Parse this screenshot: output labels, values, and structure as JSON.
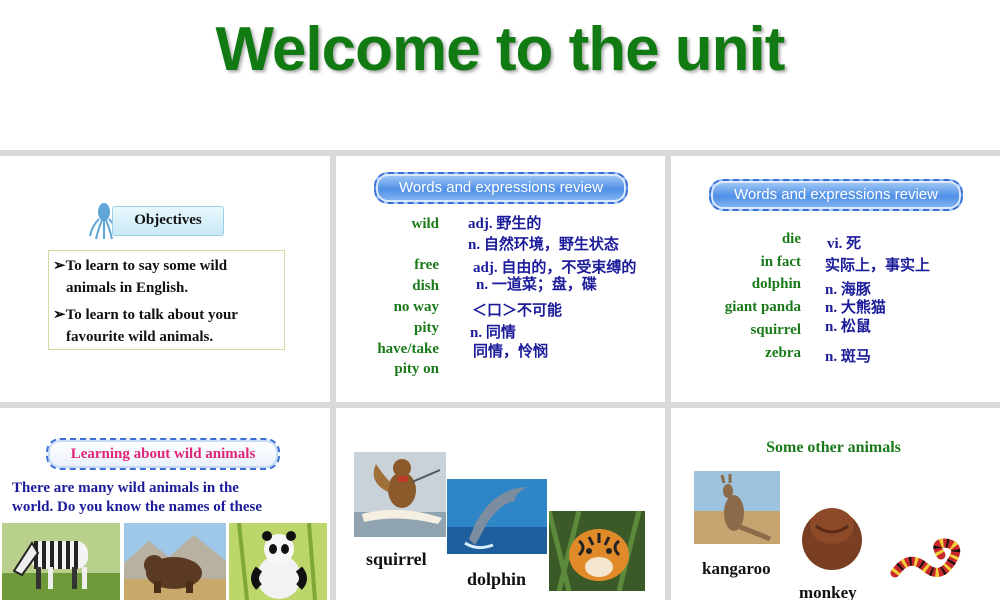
{
  "title": "Welcome to the unit",
  "objectives": {
    "label": "Objectives",
    "lines": [
      "➢To learn to say some wild",
      "animals in English.",
      "➢To learn to talk about your",
      "favourite wild animals."
    ]
  },
  "review_label": "Words and expressions review",
  "vocab1": {
    "words": [
      "wild",
      "free",
      "dish",
      "no way",
      "pity",
      "have/take",
      "pity on"
    ],
    "meanings": [
      "adj.  野生的",
      "n.  自然环境，野生状态",
      "adj.  自由的，不受束缚的",
      "n.  一道菜；盘，碟",
      "＜口＞不可能",
      "n.  同情",
      "同情，怜悯"
    ]
  },
  "vocab2": {
    "words": [
      "die",
      "in fact",
      "dolphin",
      "giant panda",
      "squirrel",
      "zebra"
    ],
    "meanings": [
      "vi.  死",
      "实际上，事实上",
      "n.  海豚",
      "n.  大熊猫",
      "n.  松鼠",
      "n.  斑马"
    ]
  },
  "learning": {
    "label": "Learning about wild animals",
    "text1": "There are many wild animals in the",
    "text2": "world. Do you know the names of these"
  },
  "captions": {
    "squirrel": "squirrel",
    "dolphin": "dolphin",
    "kangaroo": "kangaroo",
    "monkey": "monkey"
  },
  "other_animals_label": "Some other animals",
  "colors": {
    "title": "#127a12",
    "word": "#1a7a1a",
    "meaning": "#1c1c9a",
    "pill": "#4f8fe6",
    "learning": "#e0267a"
  }
}
